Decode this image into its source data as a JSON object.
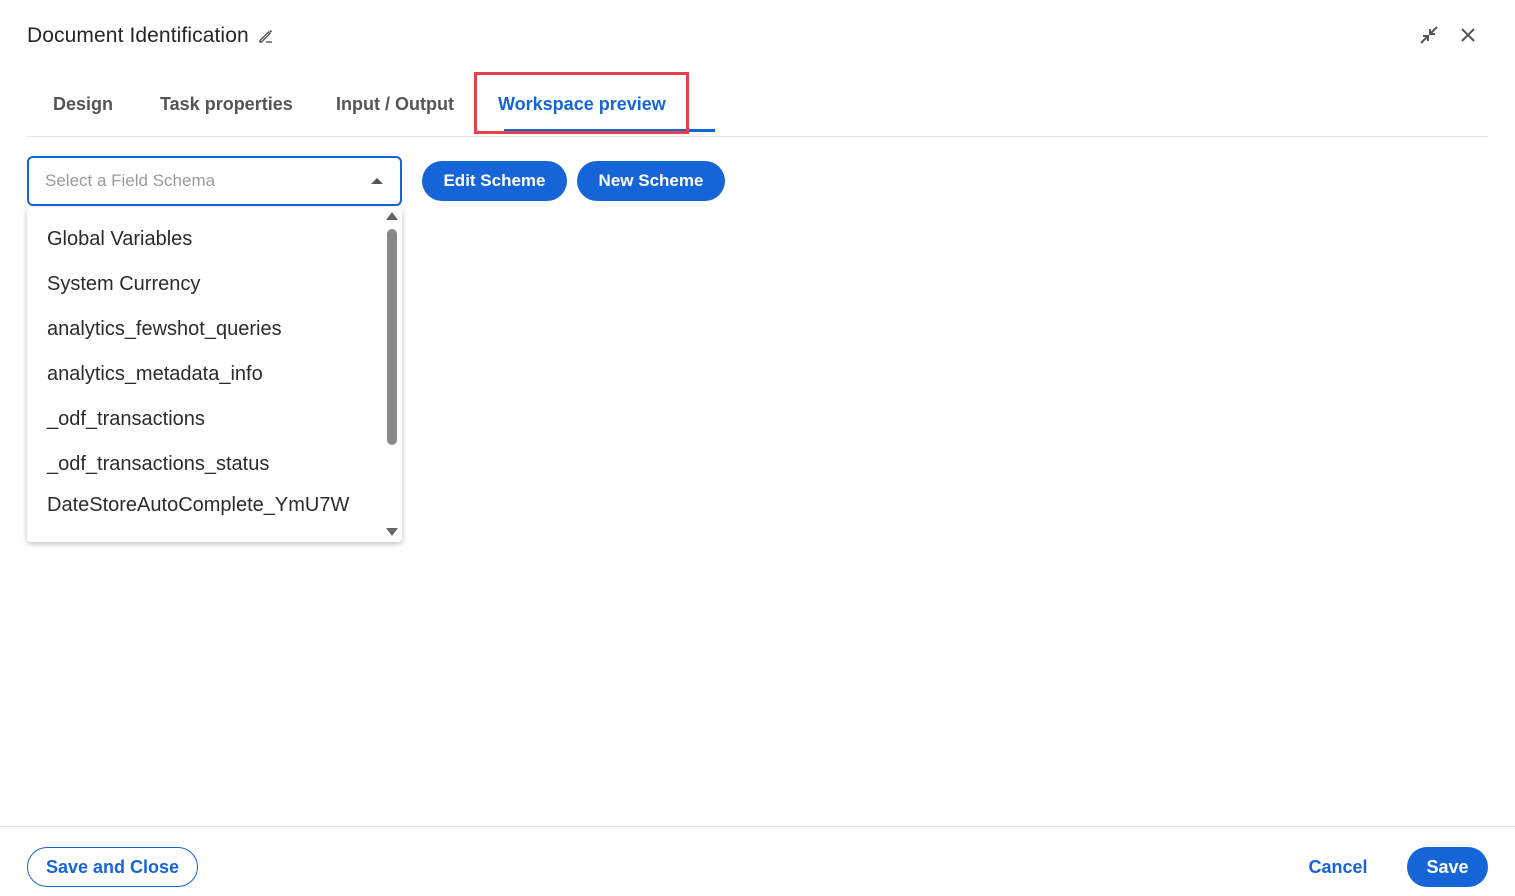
{
  "header": {
    "title": "Document Identification",
    "title_edit_icon": "pencil-icon",
    "minimize_icon": "collapse-arrows-icon",
    "close_icon": "close-icon"
  },
  "tabs": [
    {
      "label": "Design",
      "active": false
    },
    {
      "label": "Task properties",
      "active": false
    },
    {
      "label": "Input / Output",
      "active": false
    },
    {
      "label": "Workspace preview",
      "active": true
    }
  ],
  "field_schema": {
    "placeholder": "Select a Field Schema",
    "edit_button": "Edit Scheme",
    "new_button": "New Scheme",
    "options": [
      "Global Variables",
      "System Currency",
      "analytics_fewshot_queries",
      "analytics_metadata_info",
      "_odf_transactions",
      "_odf_transactions_status",
      "DateStoreAutoComplete_YmU7W"
    ]
  },
  "footer": {
    "save_close": "Save and Close",
    "cancel": "Cancel",
    "save": "Save"
  },
  "colors": {
    "accent": "#1565d8",
    "highlight": "#e5404b"
  }
}
